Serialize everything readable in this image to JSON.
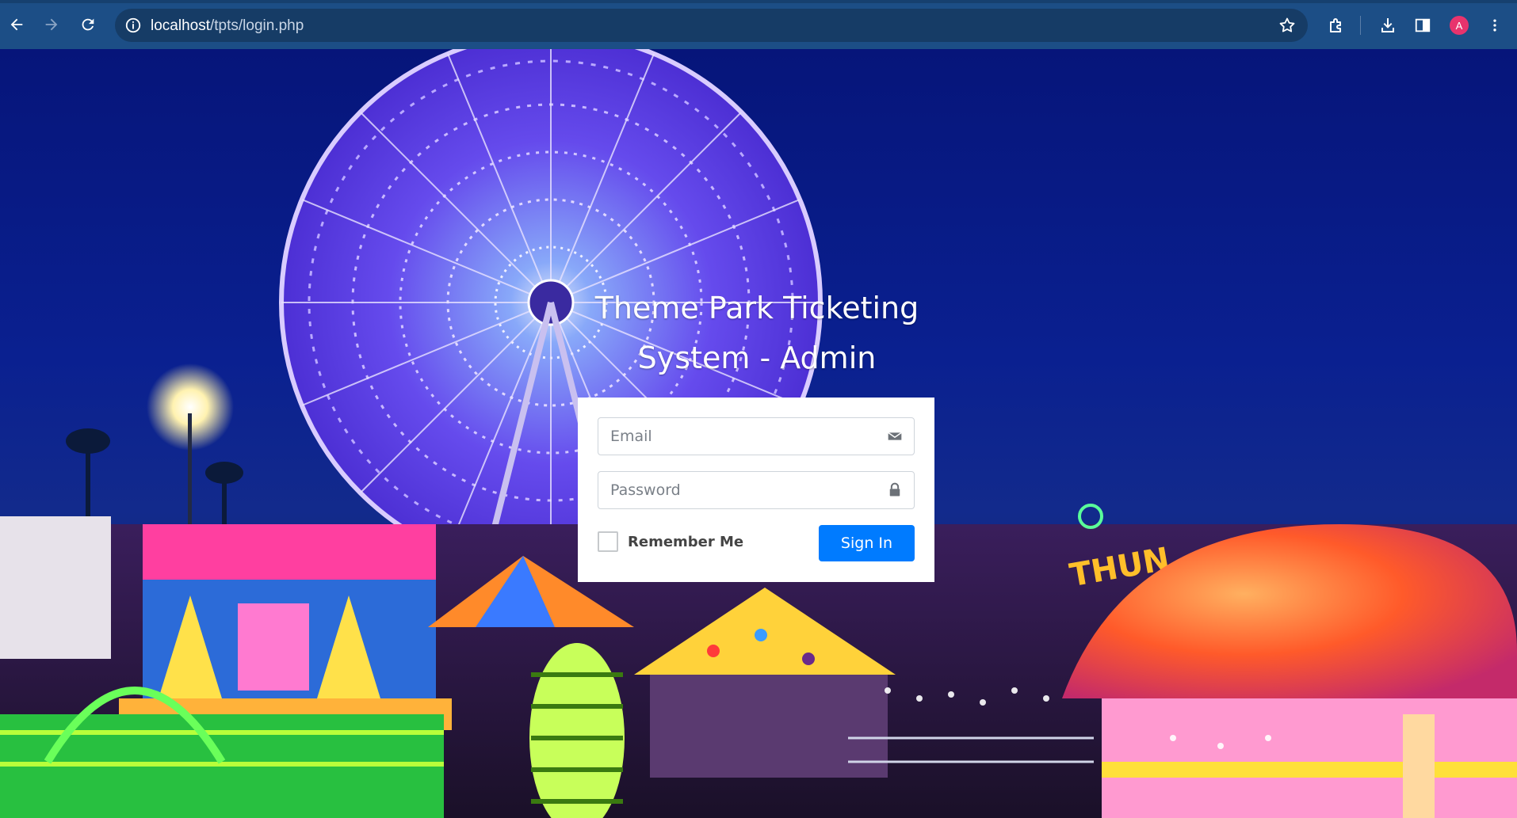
{
  "browser": {
    "url_host": "localhost",
    "url_path": "/tpts/login.php",
    "profile_initial": "A",
    "icons": [
      "back-icon",
      "forward-icon",
      "reload-icon",
      "site-info-icon",
      "bookmark-star-icon",
      "extensions-icon",
      "download-icon",
      "side-panel-icon",
      "menu-icon"
    ]
  },
  "login": {
    "title": "Theme Park Ticketing System - Admin",
    "email_placeholder": "Email",
    "password_placeholder": "Password",
    "remember_label": "Remember Me",
    "signin_label": "Sign In"
  },
  "colors": {
    "primary": "#007bff",
    "browser_bar": "#1c4e86",
    "avatar": "#e8336d"
  }
}
